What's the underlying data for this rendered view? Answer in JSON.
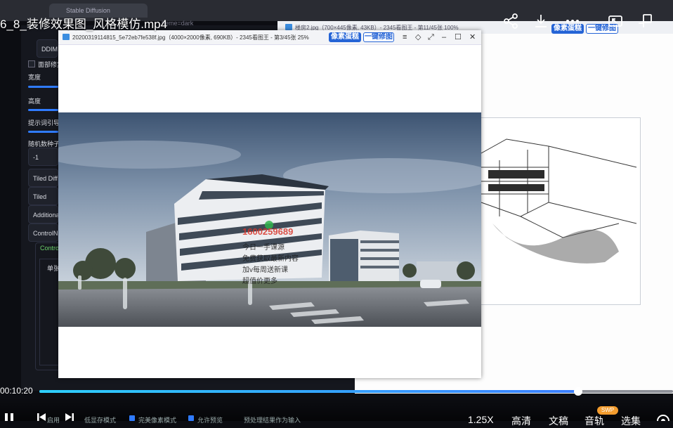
{
  "video": {
    "title": "6_8_装修效果图_风格模仿.mp4",
    "current_time": "00:10:20",
    "progress": 0.85,
    "speed": "1.25X",
    "quality": "高清",
    "subtitle": "文稿",
    "seek": "音轨",
    "episodes": "选集",
    "swp_badge": "SWP",
    "colors": {
      "progress_start": "#2ed0ff",
      "progress_end": "#3a7dff"
    }
  },
  "background": {
    "browser_tab": "Stable Diffusion",
    "url_fragment": "heme=dark",
    "sd_panel": {
      "sampler_value": "DDIM",
      "checkbox_label": "面部修复",
      "width_label": "宽度",
      "height_label": "高度",
      "prompt_guide_label": "提示词引导",
      "seed_label": "随机数种子",
      "seed_value": "-1",
      "accordions": [
        "Tiled Diff",
        "Tiled VAD",
        "Additiona",
        "ControlN"
      ],
      "controlnet_tab": "Contro",
      "unit_tab": "单张",
      "bottom_options": [
        "启用",
        "低显存模式",
        "完美像素模式",
        "允许预览",
        "预处理结果作为输入"
      ]
    },
    "viewer2": {
      "title": "楼房2.jpg（700×445像素, 43KB）- 2345看图王 - 第11/45张 100%",
      "btn_pixel": "像素蛋糕",
      "btn_fix": "一键修图"
    }
  },
  "viewer": {
    "title": "20200319114815_5e72eb7fe538f.jpg（4000×2000像素, 690KB）- 2345看图王 - 第3/45张 25%",
    "btn_pixel": "像素蛋糕",
    "btn_fix": "一键修图",
    "watermark_phone": "1600259689",
    "watermark_lines": [
      "今日一手课源",
      "免费获取最新内容",
      "加v每周送新课",
      "超值价更多"
    ]
  }
}
